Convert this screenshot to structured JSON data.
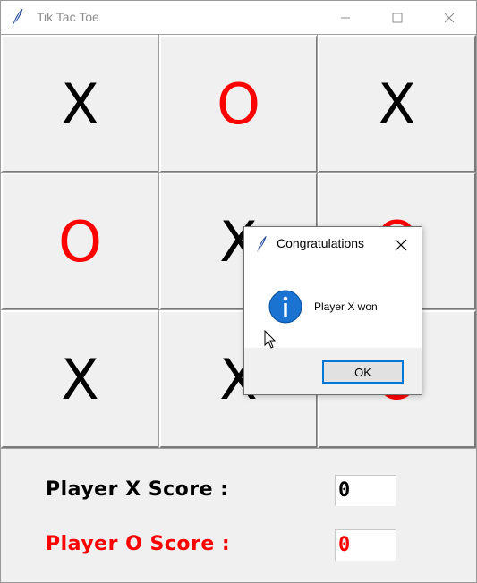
{
  "window": {
    "title": "Tik Tac Toe",
    "icon": "feather-icon",
    "controls": [
      "minimize-icon",
      "maximize-icon",
      "close-icon"
    ]
  },
  "board": {
    "cells": [
      [
        "X",
        "O",
        "X"
      ],
      [
        "O",
        "X",
        "O"
      ],
      [
        "X",
        "X",
        "O"
      ]
    ],
    "colors": {
      "X": "#000000",
      "O": "#ff0000"
    }
  },
  "scores": {
    "x_label": "Player X Score :",
    "x_value": "0",
    "o_label": "Player O Score :",
    "o_value": "0"
  },
  "dialog": {
    "title": "Congratulations",
    "icon": "info-icon",
    "message": "Player X won",
    "ok_label": "OK",
    "accent": "#0078d7"
  }
}
